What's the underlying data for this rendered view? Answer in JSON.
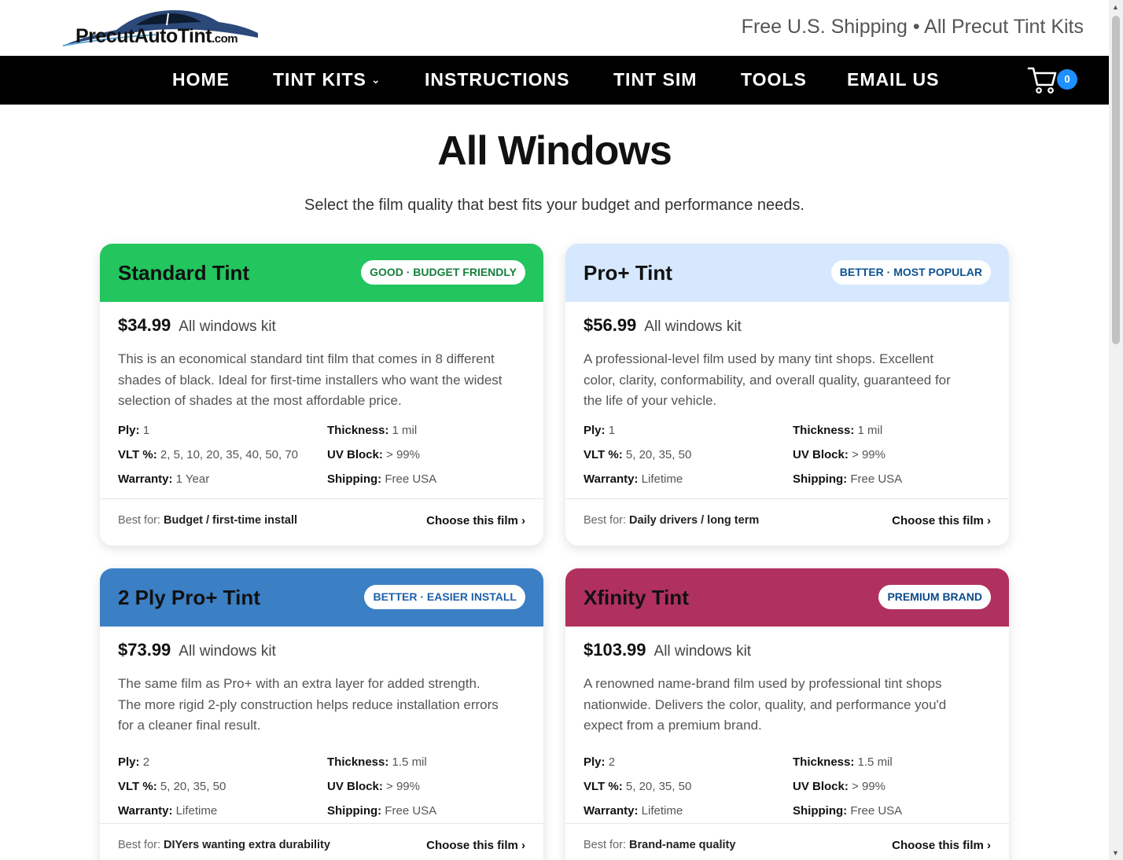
{
  "header": {
    "logo_main": "PrecutAutoTint",
    "logo_suffix": ".com",
    "tagline": "Free U.S. Shipping • All Precut Tint Kits"
  },
  "nav": {
    "home": "HOME",
    "tint_kits": "TINT KITS",
    "instructions": "INSTRUCTIONS",
    "tint_sim": "TINT SIM",
    "tools": "TOOLS",
    "email_us": "EMAIL US",
    "cart_count": "0"
  },
  "main": {
    "title": "All Windows",
    "subtitle": "Select the film quality that best fits your budget and performance needs."
  },
  "labels": {
    "ply": "Ply:",
    "thickness": "Thickness:",
    "vlt": "VLT %:",
    "uv": "UV Block:",
    "warranty": "Warranty:",
    "shipping": "Shipping:",
    "best_for": "Best for:",
    "choose": "Choose this film ›",
    "kit_note": "All windows kit"
  },
  "cards": [
    {
      "name": "Standard Tint",
      "badge": "GOOD · BUDGET FRIENDLY",
      "head_color": "#22c55e",
      "badge_color": "#15803d",
      "price": "$34.99",
      "description": "This is an economical standard tint film that comes in 8 different shades of black. Ideal for first-time installers who want the widest selection of shades at the most affordable price.",
      "ply": "1",
      "thickness": "1 mil",
      "vlt": "2, 5, 10, 20, 35, 40, 50, 70",
      "uv": "> 99%",
      "warranty": "1 Year",
      "shipping": "Free USA",
      "best_for": "Budget / first-time install"
    },
    {
      "name": "Pro+ Tint",
      "badge": "BETTER · MOST POPULAR",
      "head_color": "#d6e8fd",
      "badge_color": "#0b5394",
      "price": "$56.99",
      "description": "A professional-level film used by many tint shops. Excellent color, clarity, conformability, and overall quality, guaranteed for the life of your vehicle.",
      "ply": "1",
      "thickness": "1 mil",
      "vlt": "5, 20, 35, 50",
      "uv": "> 99%",
      "warranty": "Lifetime",
      "shipping": "Free USA",
      "best_for": "Daily drivers / long term"
    },
    {
      "name": "2 Ply Pro+ Tint",
      "badge": "BETTER · EASIER INSTALL",
      "head_color": "#3b7fc4",
      "badge_color": "#1d5fa8",
      "price": "$73.99",
      "description": "The same film as Pro+ with an extra layer for added strength. The more rigid 2-ply construction helps reduce installation errors for a cleaner final result.",
      "ply": "2",
      "thickness": "1.5 mil",
      "vlt": "5, 20, 35, 50",
      "uv": "> 99%",
      "warranty": "Lifetime",
      "shipping": "Free USA",
      "best_for": "DIYers wanting extra durability"
    },
    {
      "name": "Xfinity Tint",
      "badge": "PREMIUM BRAND",
      "head_color": "#b0305e",
      "badge_color": "#0b4a8a",
      "price": "$103.99",
      "description": "A renowned name-brand film used by professional tint shops nationwide. Delivers the color, quality, and performance you'd expect from a premium brand.",
      "ply": "2",
      "thickness": "1.5 mil",
      "vlt": "5, 20, 35, 50",
      "uv": "> 99%",
      "warranty": "Lifetime",
      "shipping": "Free USA",
      "best_for": "Brand-name quality"
    }
  ]
}
